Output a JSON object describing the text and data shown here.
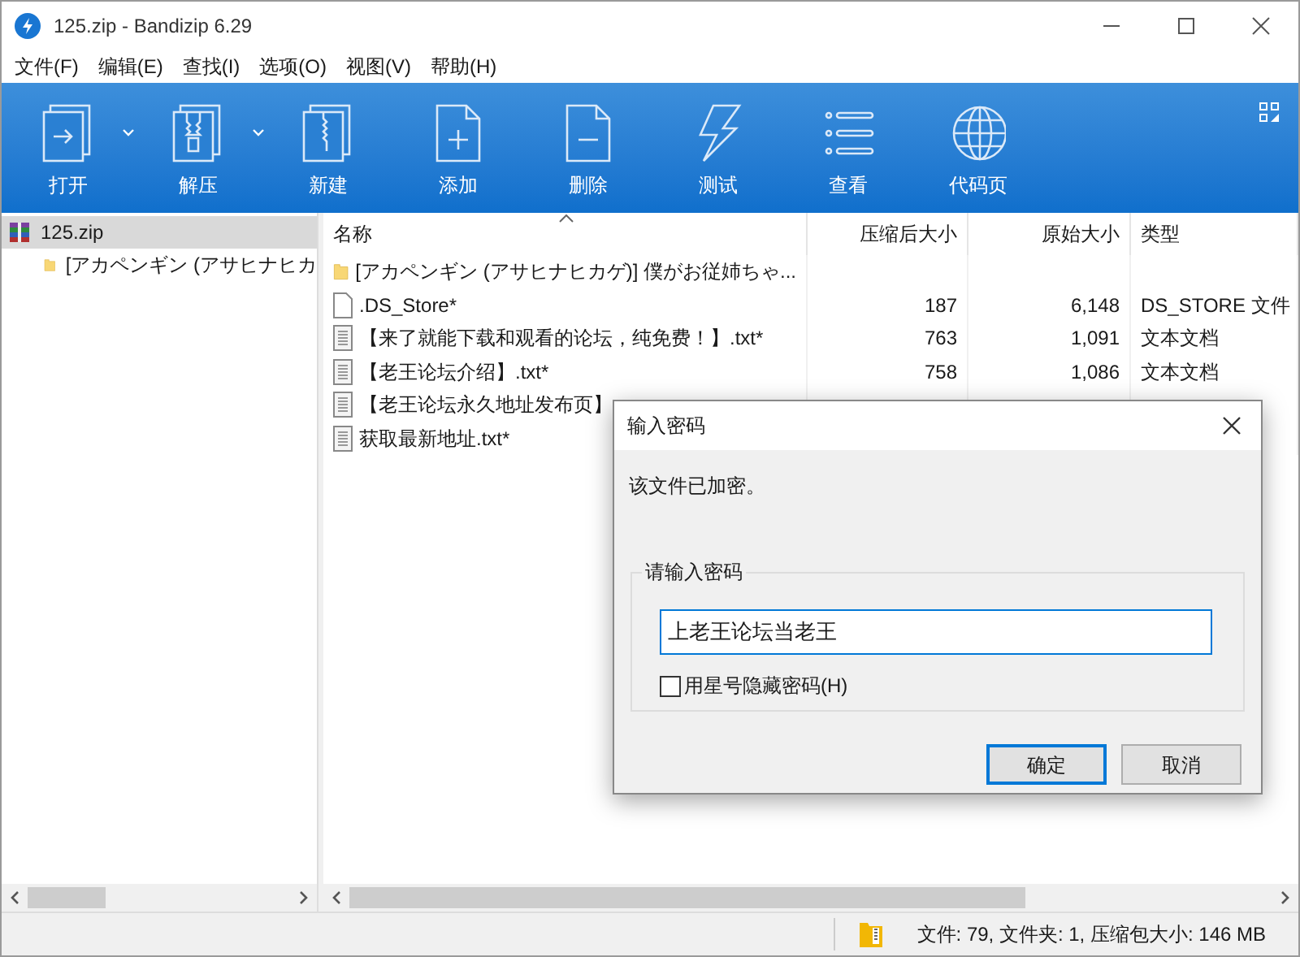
{
  "window": {
    "title": "125.zip - Bandizip 6.29"
  },
  "menu": [
    "文件(F)",
    "编辑(E)",
    "查找(I)",
    "选项(O)",
    "视图(V)",
    "帮助(H)"
  ],
  "toolbar": [
    {
      "kind": "open",
      "label": "打开",
      "dropdown": true
    },
    {
      "kind": "extract",
      "label": "解压",
      "dropdown": true
    },
    {
      "kind": "new",
      "label": "新建",
      "dropdown": false
    },
    {
      "kind": "add",
      "label": "添加",
      "dropdown": false
    },
    {
      "kind": "delete",
      "label": "删除",
      "dropdown": false
    },
    {
      "kind": "test",
      "label": "测试",
      "dropdown": false
    },
    {
      "kind": "view",
      "label": "查看",
      "dropdown": false
    },
    {
      "kind": "codepage",
      "label": "代码页",
      "dropdown": false
    }
  ],
  "tree": [
    {
      "label": "125.zip",
      "kind": "archive",
      "selected": true,
      "children": [
        {
          "label": "[アカペンギン (アサヒナヒカ",
          "kind": "folder",
          "selected": false
        }
      ]
    }
  ],
  "table": {
    "columns": [
      "名称",
      "压缩后大小",
      "原始大小",
      "类型"
    ],
    "rows": [
      {
        "kind": "folder",
        "name": "[アカペンギン (アサヒナヒカゲ)] 僕がお従姉ちゃ...",
        "compressed": "",
        "original": "",
        "type": ""
      },
      {
        "kind": "file",
        "name": ".DS_Store*",
        "compressed": "187",
        "original": "6,148",
        "type": "DS_STORE 文件"
      },
      {
        "kind": "text",
        "name": "【来了就能下载和观看的论坛，纯免费！】.txt*",
        "compressed": "763",
        "original": "1,091",
        "type": "文本文档"
      },
      {
        "kind": "text",
        "name": "【老王论坛介绍】.txt*",
        "compressed": "758",
        "original": "1,086",
        "type": "文本文档"
      },
      {
        "kind": "text",
        "name": "【老王论坛永久地址发布页】",
        "compressed": "",
        "original": "",
        "type": ""
      },
      {
        "kind": "text",
        "name": "获取最新地址.txt*",
        "compressed": "",
        "original": "",
        "type": ""
      }
    ]
  },
  "status_bar": "文件: 79, 文件夹: 1, 压缩包大小: 146 MB",
  "dialog": {
    "title": "输入密码",
    "message": "该文件已加密。",
    "group": "请输入密码",
    "value": "上老王论坛当老王",
    "checkbox": {
      "label": "用星号隐藏密码(H)",
      "checked": false
    },
    "buttons": [
      {
        "label": "确定",
        "default": true
      },
      {
        "label": "取消",
        "default": false
      }
    ]
  }
}
